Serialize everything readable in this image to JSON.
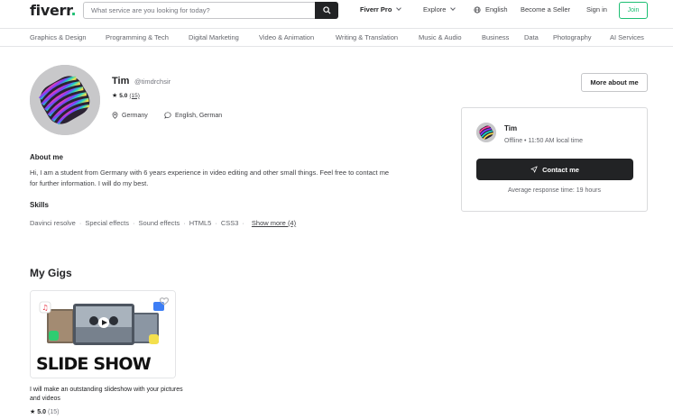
{
  "header": {
    "logo": "fiverr",
    "logo_dot": ".",
    "search_placeholder": "What service are you looking for today?",
    "nav": {
      "fiverr_pro": "Fiverr Pro",
      "explore": "Explore",
      "language": "English",
      "become_seller": "Become a Seller",
      "sign_in": "Sign in",
      "join": "Join"
    }
  },
  "categories": [
    "Graphics & Design",
    "Programming & Tech",
    "Digital Marketing",
    "Video & Animation",
    "Writing & Translation",
    "Music & Audio",
    "Business",
    "Data",
    "Photography",
    "AI Services"
  ],
  "profile": {
    "name": "Tim",
    "handle": "@timdrchsir",
    "rating": "5.0",
    "reviews": "(15)",
    "location": "Germany",
    "languages": "English, German",
    "more_about_me": "More about me"
  },
  "contact_card": {
    "name": "Tim",
    "status": "Offline • 11:50 AM local time",
    "contact_button": "Contact me",
    "response_time": "Average response time: 19 hours"
  },
  "about": {
    "heading": "About me",
    "text": "Hi, I am a student from Germany with 6 years experience in video editing and other small things. Feel free to contact me for further information. I will do my best."
  },
  "skills": {
    "heading": "Skills",
    "items": [
      "Davinci resolve",
      "Special effects",
      "Sound effects",
      "HTML5",
      "CSS3"
    ],
    "show_more": "Show more (4)"
  },
  "gigs": {
    "heading": "My Gigs",
    "items": [
      {
        "image_text": "SLIDE SHOW",
        "title": "I will make an outstanding slideshow with your pictures and videos",
        "rating": "5.0",
        "reviews": "(15)"
      }
    ]
  }
}
